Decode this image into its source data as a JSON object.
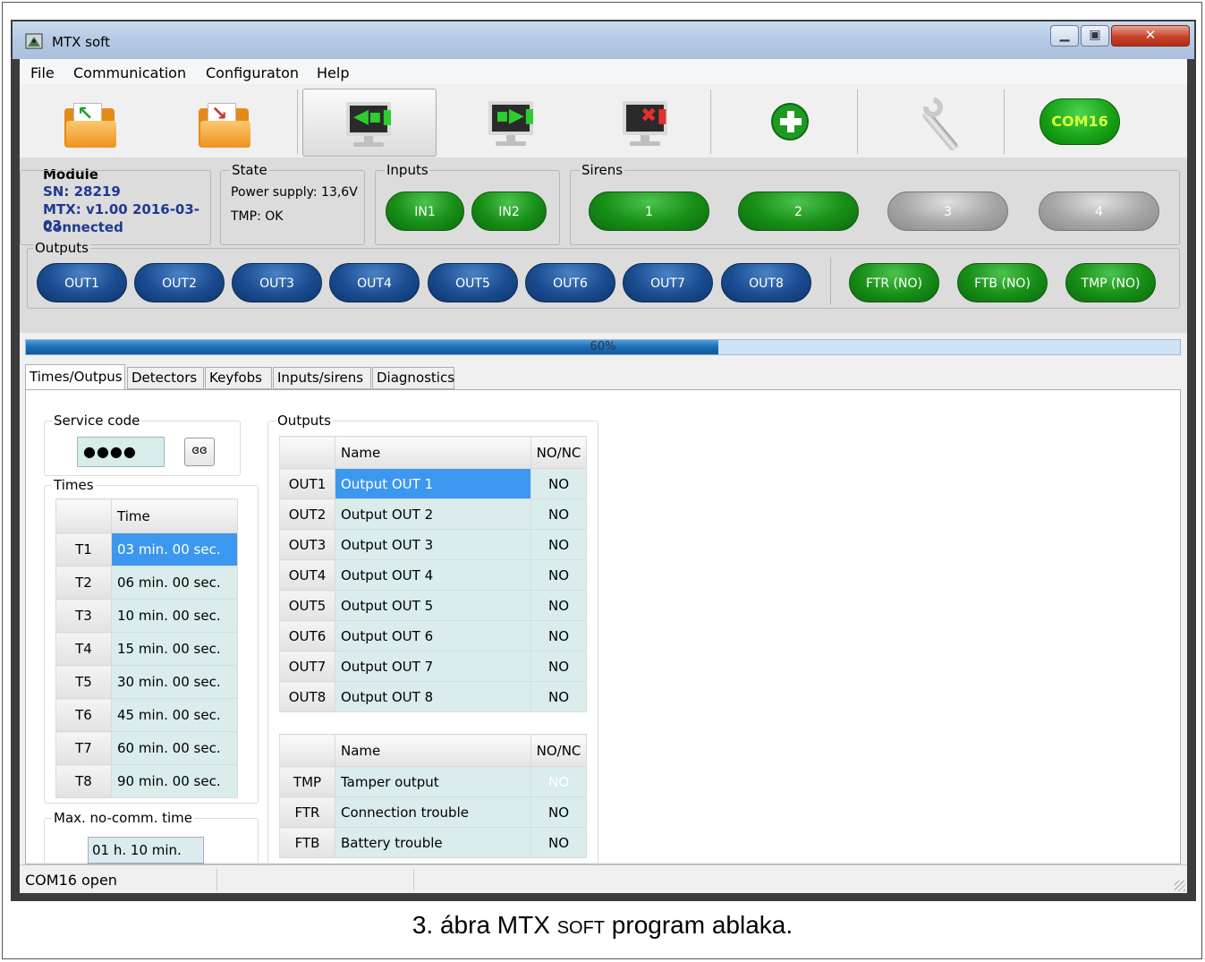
{
  "window": {
    "title": "MTX soft"
  },
  "menu": [
    "File",
    "Communication",
    "Configuraton",
    "Help"
  ],
  "toolbar": {
    "com_port": "COM16"
  },
  "module": {
    "label": "Module",
    "sn": "SN:  28219",
    "version": "MTX: v1.00 2016-03-03",
    "status": "Connected"
  },
  "state": {
    "label": "State",
    "power": "Power supply: 13,6V",
    "tmp": "TMP: OK"
  },
  "inputs": {
    "label": "Inputs",
    "items": [
      "IN1",
      "IN2"
    ]
  },
  "sirens": {
    "label": "Sirens",
    "items": [
      "1",
      "2",
      "3",
      "4"
    ],
    "active": [
      true,
      true,
      false,
      false
    ]
  },
  "outputs_panel": {
    "label": "Outputs",
    "items": [
      "OUT1",
      "OUT2",
      "OUT3",
      "OUT4",
      "OUT5",
      "OUT6",
      "OUT7",
      "OUT8"
    ],
    "special": [
      "FTR (NO)",
      "FTB (NO)",
      "TMP (NO)"
    ]
  },
  "progress": {
    "value": 60,
    "text": "60%"
  },
  "tabs": [
    "Times/Outpus",
    "Detectors",
    "Keyfobs",
    "Inputs/sirens",
    "Diagnostics"
  ],
  "service_code": {
    "label": "Service code",
    "value": "●●●●",
    "reveal_icon": "glasses-icon"
  },
  "times": {
    "label": "Times",
    "header": "Time",
    "rows": [
      {
        "id": "T1",
        "value": "03 min. 00 sec."
      },
      {
        "id": "T2",
        "value": "06 min. 00 sec."
      },
      {
        "id": "T3",
        "value": "10 min. 00 sec."
      },
      {
        "id": "T4",
        "value": "15 min. 00 sec."
      },
      {
        "id": "T5",
        "value": "30 min. 00 sec."
      },
      {
        "id": "T6",
        "value": "45 min. 00 sec."
      },
      {
        "id": "T7",
        "value": "60 min. 00 sec."
      },
      {
        "id": "T8",
        "value": "90 min. 00 sec."
      }
    ]
  },
  "max_nocomm": {
    "label": "Max. no-comm. time",
    "value": "01 h. 10 min."
  },
  "outputs_table": {
    "label": "Outputs",
    "headers": [
      "Name",
      "NO/NC"
    ],
    "rows": [
      {
        "id": "OUT1",
        "name": "Output OUT 1",
        "mode": "NO"
      },
      {
        "id": "OUT2",
        "name": "Output OUT 2",
        "mode": "NO"
      },
      {
        "id": "OUT3",
        "name": "Output OUT 3",
        "mode": "NO"
      },
      {
        "id": "OUT4",
        "name": "Output OUT 4",
        "mode": "NO"
      },
      {
        "id": "OUT5",
        "name": "Output OUT 5",
        "mode": "NO"
      },
      {
        "id": "OUT6",
        "name": "Output OUT 6",
        "mode": "NO"
      },
      {
        "id": "OUT7",
        "name": "Output OUT 7",
        "mode": "NO"
      },
      {
        "id": "OUT8",
        "name": "Output OUT 8",
        "mode": "NO"
      }
    ]
  },
  "trouble_table": {
    "headers": [
      "Name",
      "NO/NC"
    ],
    "rows": [
      {
        "id": "TMP",
        "name": "Tamper output",
        "mode": "NO"
      },
      {
        "id": "FTR",
        "name": "Connection trouble",
        "mode": "NO"
      },
      {
        "id": "FTB",
        "name": "Battery trouble",
        "mode": "NO"
      }
    ]
  },
  "statusbar": {
    "text": "COM16 open"
  },
  "caption": {
    "prefix": "3. ábra MTX ",
    "smallcaps": "SOFT",
    "suffix": " program ablaka."
  },
  "colors": {
    "green": "#178f17",
    "blue": "#1b4d92",
    "selection": "#3c98ee"
  }
}
